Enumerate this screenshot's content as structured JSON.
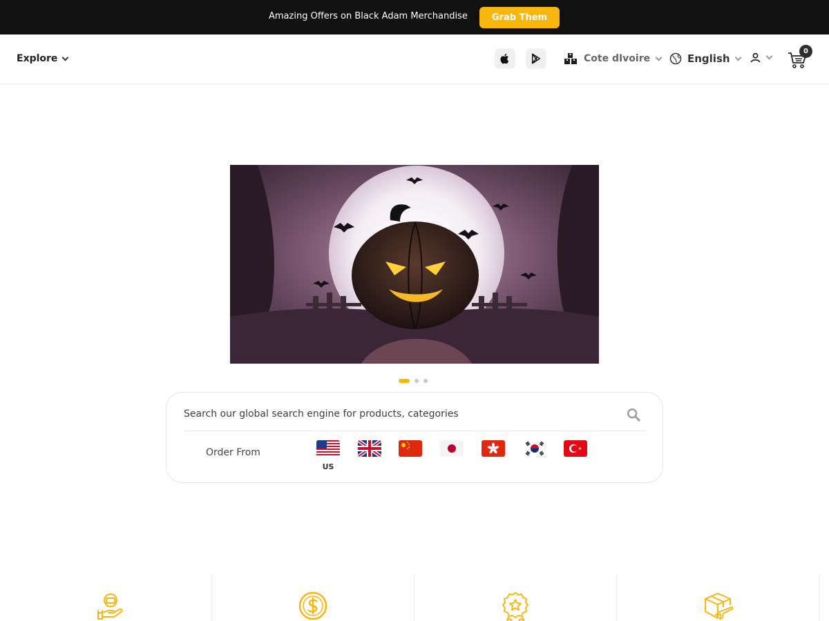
{
  "promo": {
    "text": "Amazing Offers on Black Adam Merchandise",
    "button": "Grab Them"
  },
  "header": {
    "explore_label": "Explore",
    "stores": [
      {
        "icon": "apple-icon"
      },
      {
        "icon": "google-play-icon"
      }
    ],
    "country": {
      "icon": "warehouse-icon",
      "label": "Cote dIvoire"
    },
    "language": {
      "icon": "globe-icon",
      "label": "English"
    },
    "account": {
      "icon": "user-icon"
    },
    "cart": {
      "icon": "cart-icon",
      "count": "0"
    }
  },
  "carousel": {
    "slides": 3,
    "active": 1,
    "image": "halloween-pumpkin-banner"
  },
  "search": {
    "placeholder": "Search our global search engine for products, categories",
    "order_from_label": "Order From",
    "countries": [
      {
        "code": "US",
        "label": "US",
        "selected": true
      },
      {
        "code": "UK",
        "selected": false
      },
      {
        "code": "CN",
        "selected": false
      },
      {
        "code": "JP",
        "selected": false
      },
      {
        "code": "HK",
        "selected": false
      },
      {
        "code": "KR",
        "selected": false
      },
      {
        "code": "TR",
        "selected": false
      }
    ]
  },
  "features": [
    {
      "icon": "cash-hand-icon"
    },
    {
      "icon": "dollar-coin-icon"
    },
    {
      "icon": "quality-badge-icon"
    },
    {
      "icon": "shipping-box-plane-icon"
    }
  ],
  "colors": {
    "accent": "#f7b70f",
    "promo_bg": "#111111",
    "dark": "#2d2d2d"
  }
}
